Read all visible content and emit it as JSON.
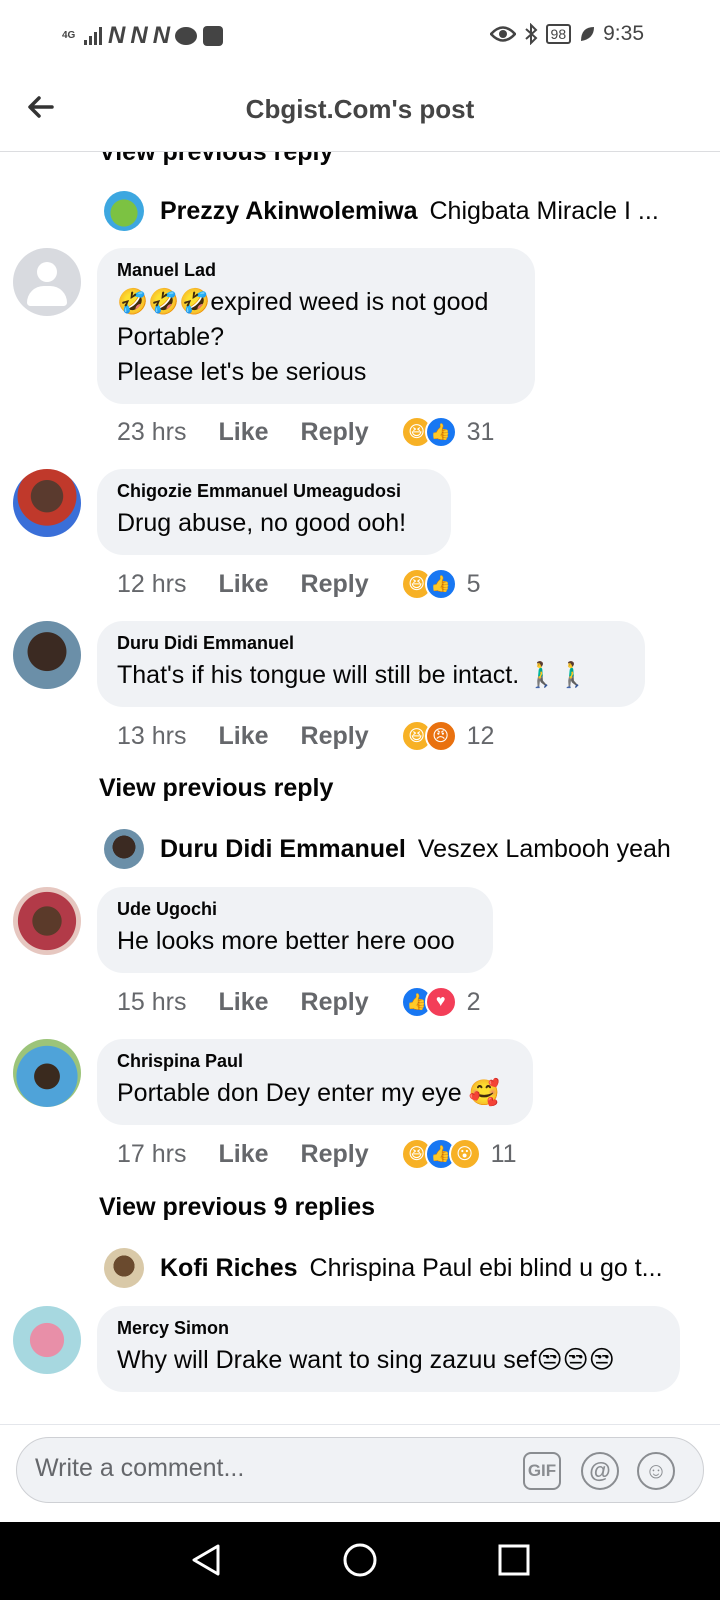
{
  "status_bar": {
    "network": "4G",
    "battery": "98",
    "time": "9:35",
    "icons": [
      "signal-icon",
      "notification-n-icon",
      "notification-n-icon",
      "notification-n-icon",
      "message-bubble-icon",
      "app-icon",
      "eye-icon",
      "bluetooth-icon",
      "battery-icon",
      "leaf-icon"
    ]
  },
  "header": {
    "title": "Cbgist.Com's post",
    "back_icon": "arrow-left-icon"
  },
  "feed": {
    "top_view_previous": "View previous reply",
    "reply_previews": [
      {
        "name": "Prezzy Akinwolemiwa",
        "text": "Chigbata Miracle I ..."
      },
      {
        "name": "Duru Didi Emmanuel",
        "text": "Veszex Lambooh yeah"
      },
      {
        "name": "Kofi Riches",
        "text": "Chrispina Paul ebi blind u go t..."
      }
    ],
    "view_previous": [
      "View previous reply",
      "View previous 9 replies"
    ],
    "comments": [
      {
        "name": "Manuel Lad",
        "text": "🤣🤣🤣expired weed is not good\nPortable?\nPlease let's be serious",
        "time": "23 hrs",
        "like": "Like",
        "reply": "Reply",
        "reactions": [
          "haha",
          "like"
        ],
        "count": "31"
      },
      {
        "name": "Chigozie Emmanuel Umeagudosi",
        "text": "Drug abuse, no good ooh!",
        "time": "12 hrs",
        "like": "Like",
        "reply": "Reply",
        "reactions": [
          "haha",
          "like"
        ],
        "count": "5"
      },
      {
        "name": "Duru Didi Emmanuel",
        "text": "That's if his tongue will still be intact. 🚶‍♂️🚶‍♂️",
        "time": "13 hrs",
        "like": "Like",
        "reply": "Reply",
        "reactions": [
          "haha",
          "angry"
        ],
        "count": "12"
      },
      {
        "name": "Ude Ugochi",
        "text": "He looks more better here ooo",
        "time": "15 hrs",
        "like": "Like",
        "reply": "Reply",
        "reactions": [
          "like",
          "love"
        ],
        "count": "2"
      },
      {
        "name": "Chrispina Paul",
        "text": "Portable don Dey enter my eye 🥰",
        "time": "17 hrs",
        "like": "Like",
        "reply": "Reply",
        "reactions": [
          "haha",
          "like",
          "wow"
        ],
        "count": "11"
      },
      {
        "name": "Mercy Simon",
        "text": "Why will Drake want to sing zazuu sef😒😒😒"
      }
    ]
  },
  "composer": {
    "placeholder": "Write a comment...",
    "gif_label": "GIF",
    "at_label": "@",
    "emoji_label": "☺"
  },
  "colors": {
    "bubble": "#f0f2f5",
    "meta": "#65676b",
    "like_blue": "#1877f2",
    "haha_yellow": "#f7b125"
  }
}
